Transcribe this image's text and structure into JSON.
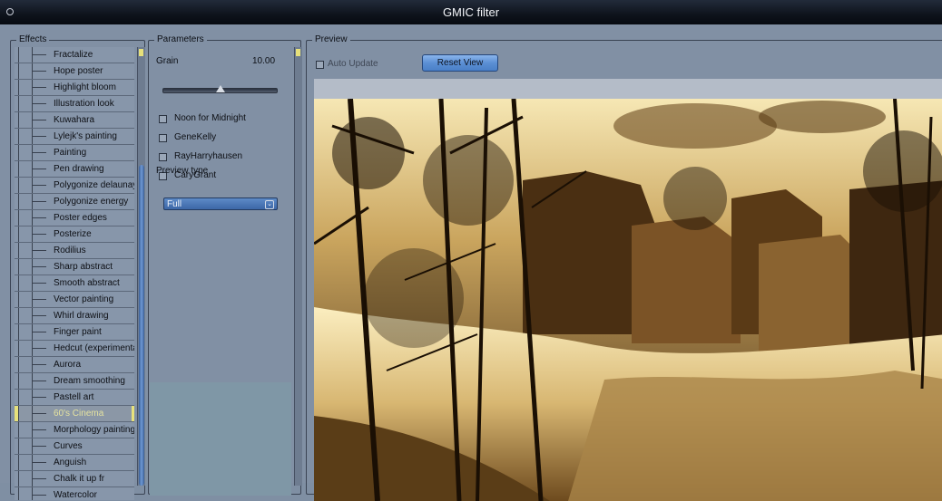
{
  "window": {
    "title": "GMIC filter"
  },
  "effects": {
    "label": "Effects",
    "items": [
      "Fractalize",
      "Hope poster",
      "Highlight bloom",
      "Illustration look",
      "Kuwahara",
      "Lylejk's painting",
      "Painting",
      "Pen drawing",
      "Polygonize delaunay",
      "Polygonize energy",
      "Poster edges",
      "Posterize",
      "Rodilius",
      "Sharp abstract",
      "Smooth abstract",
      "Vector painting",
      "Whirl drawing",
      "Finger paint",
      "Hedcut (experimental)",
      "Aurora",
      "Dream smoothing",
      "Pastell art",
      "60's Cinema",
      "Morphology painting",
      "Curves",
      "Anguish",
      "Chalk it up fr",
      "Watercolor"
    ],
    "selected": "60's Cinema"
  },
  "parameters": {
    "label": "Parameters",
    "grain_label": "Grain",
    "grain_value": "10.00",
    "grain_fraction": 0.5,
    "checkboxes": [
      {
        "label": "Noon for Midnight",
        "checked": false
      },
      {
        "label": "GeneKelly",
        "checked": false
      },
      {
        "label": "RayHarryhausen",
        "checked": false
      },
      {
        "label": "CaryGrant",
        "checked": false
      }
    ],
    "preview_type_label": "Preview type",
    "preview_type_value": "Full"
  },
  "preview": {
    "label": "Preview",
    "auto_update_label": "Auto Update",
    "auto_update_checked": false,
    "reset_view_label": "Reset View"
  },
  "colors": {
    "accent": "#5b8fd4",
    "selection": "#e7e17b",
    "sepia_dark": "#1a0f04",
    "sepia_light": "#f3e2a8"
  }
}
